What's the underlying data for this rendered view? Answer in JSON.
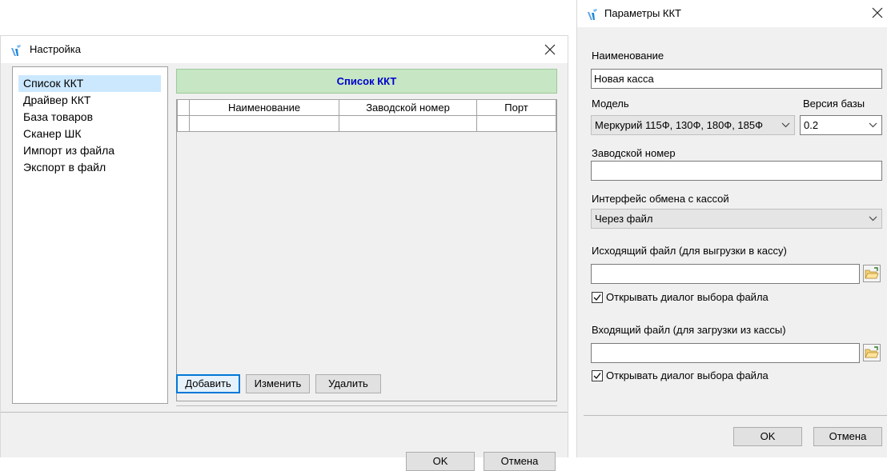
{
  "settings_window": {
    "title": "Настройка",
    "nav_items": [
      {
        "label": "Список ККТ",
        "selected": true
      },
      {
        "label": "Драйвер ККТ",
        "selected": false
      },
      {
        "label": "База товаров",
        "selected": false
      },
      {
        "label": "Сканер ШК",
        "selected": false
      },
      {
        "label": "Импорт из файла",
        "selected": false
      },
      {
        "label": "Экспорт в файл",
        "selected": false
      }
    ],
    "content_header": "Список ККТ",
    "table": {
      "columns": [
        "Наименование",
        "Заводской номер",
        "Порт"
      ],
      "rows": [
        [
          "",
          "",
          ""
        ]
      ]
    },
    "buttons": {
      "add": "Добавить",
      "edit": "Изменить",
      "delete": "Удалить",
      "ok": "OK",
      "cancel": "Отмена"
    }
  },
  "params_window": {
    "title": "Параметры ККТ",
    "name_label": "Наименование",
    "name_value": "Новая касса",
    "model_label": "Модель",
    "model_value": "Меркурий 115Ф, 130Ф, 180Ф, 185Ф",
    "db_version_label": "Версия базы",
    "db_version_value": "0.2",
    "serial_label": "Заводской номер",
    "serial_value": "",
    "interface_label": "Интерфейс обмена с кассой",
    "interface_value": "Через файл",
    "outgoing_label": "Исходящий файл (для выгрузки в кассу)",
    "outgoing_value": "",
    "outgoing_checkbox_label": "Открывать диалог выбора файла",
    "outgoing_checkbox_checked": true,
    "incoming_label": "Входящий файл (для загрузки из кассы)",
    "incoming_value": "",
    "incoming_checkbox_label": "Открывать диалог выбора файла",
    "incoming_checkbox_checked": true,
    "ok_label": "OK",
    "cancel_label": "Отмена"
  },
  "colors": {
    "header_bg": "#c6e6c4",
    "header_text": "#0000cc",
    "selection": "#cce8ff",
    "logo_blue": "#1e88d8"
  },
  "icons": [
    "app-logo-icon",
    "close-icon",
    "chevron-down-icon",
    "folder-browse-icon",
    "check-icon"
  ]
}
